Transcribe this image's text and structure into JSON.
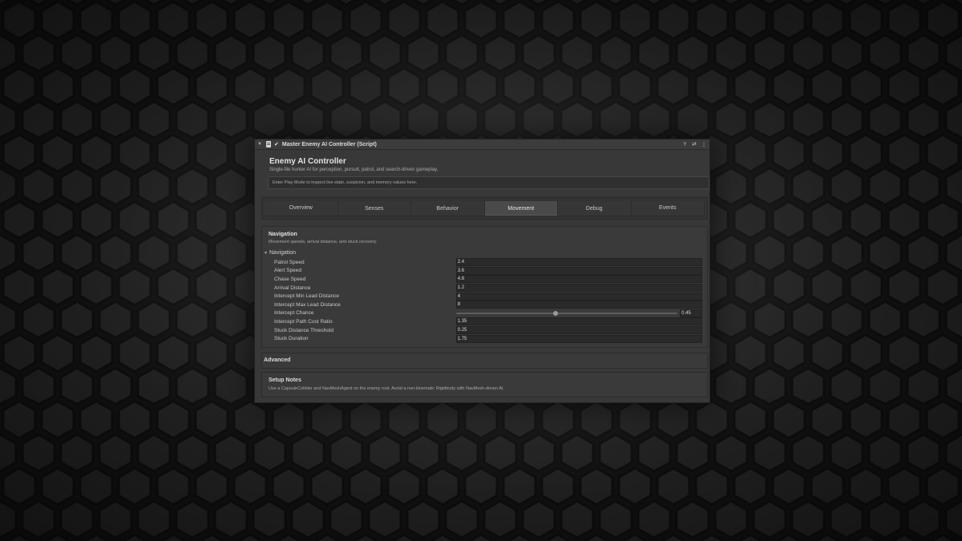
{
  "window": {
    "title": "Master Enemy AI Controller (Script)",
    "fold_icon": "triangle-down-icon",
    "enabled_check": "✔",
    "icons": [
      "help-icon",
      "preset-icon",
      "kebab-menu-icon"
    ]
  },
  "header": {
    "title": "Enemy AI Controller",
    "subtitle": "Single-file hunter AI for perception, pursuit, patrol, and search-driven gameplay.",
    "help": "Enter Play Mode to inspect live state, suspicion, and memory values here."
  },
  "tabs": [
    {
      "label": "Overview",
      "active": false
    },
    {
      "label": "Senses",
      "active": false
    },
    {
      "label": "Behavior",
      "active": false
    },
    {
      "label": "Movement",
      "active": true
    },
    {
      "label": "Debug",
      "active": false
    },
    {
      "label": "Events",
      "active": false
    }
  ],
  "navigation": {
    "title": "Navigation",
    "subtitle": "Movement speeds, arrival distance, and stuck recovery.",
    "foldout_label": "Navigation",
    "fields": [
      {
        "label": "Patrol Speed",
        "value": "2.4"
      },
      {
        "label": "Alert Speed",
        "value": "3.6"
      },
      {
        "label": "Chase Speed",
        "value": "4.8"
      },
      {
        "label": "Arrival Distance",
        "value": "1.2"
      },
      {
        "label": "Intercept Min Lead Distance",
        "value": "4"
      },
      {
        "label": "Intercept Max Lead Distance",
        "value": "8"
      },
      {
        "label": "Intercept Chance",
        "value": "0.45",
        "slider": 0.45
      },
      {
        "label": "Intercept Path Cost Ratio",
        "value": "1.35"
      },
      {
        "label": "Stuck Distance Threshold",
        "value": "0.25"
      },
      {
        "label": "Stuck Duration",
        "value": "1.75"
      }
    ]
  },
  "advanced": {
    "title": "Advanced"
  },
  "setup_notes": {
    "title": "Setup Notes",
    "text": "Use a CapsuleCollider and NavMeshAgent on the enemy root. Avoid a non-kinematic Rigidbody with NavMesh-driven AI."
  }
}
